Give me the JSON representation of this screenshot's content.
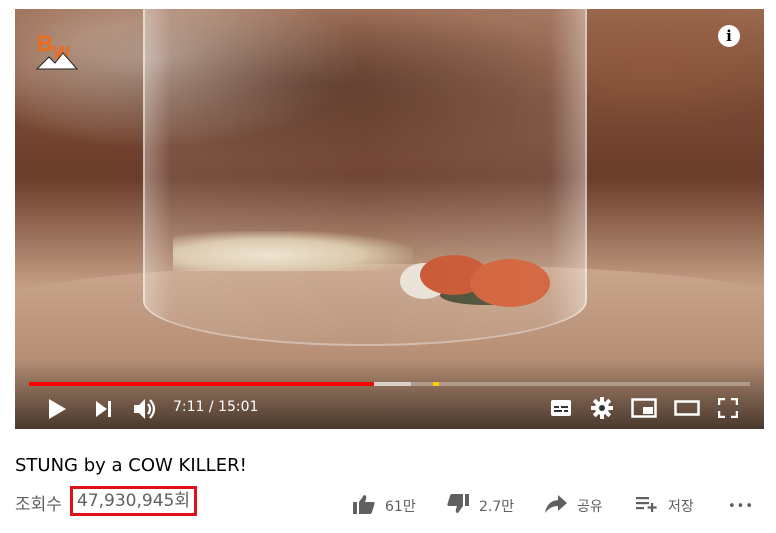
{
  "video": {
    "title": "STUNG by a COW KILLER!",
    "views_prefix": "조회수",
    "views_count": "47,930,945회",
    "current_time": "7:11",
    "duration": "15:01",
    "time_display": "7:11 / 15:01",
    "played_fraction": 0.479,
    "buffered_fraction": 0.53,
    "ad_marker_fraction": 0.56
  },
  "player_icons": {
    "play": "play-icon",
    "next": "next-icon",
    "volume": "volume-icon",
    "subtitles": "subtitles-icon",
    "settings": "gear-icon",
    "miniplayer": "miniplayer-icon",
    "theater": "theater-mode-icon",
    "fullscreen": "fullscreen-icon",
    "info": "info-icon"
  },
  "info_label": "i",
  "actions": {
    "like_count": "61만",
    "dislike_count": "2.7만",
    "share_label": "공유",
    "save_label": "저장",
    "more_label": "•••"
  },
  "colors": {
    "progress_played": "#ff0000",
    "view_highlight": "#e0101a",
    "logo_orange": "#f06a1a"
  }
}
